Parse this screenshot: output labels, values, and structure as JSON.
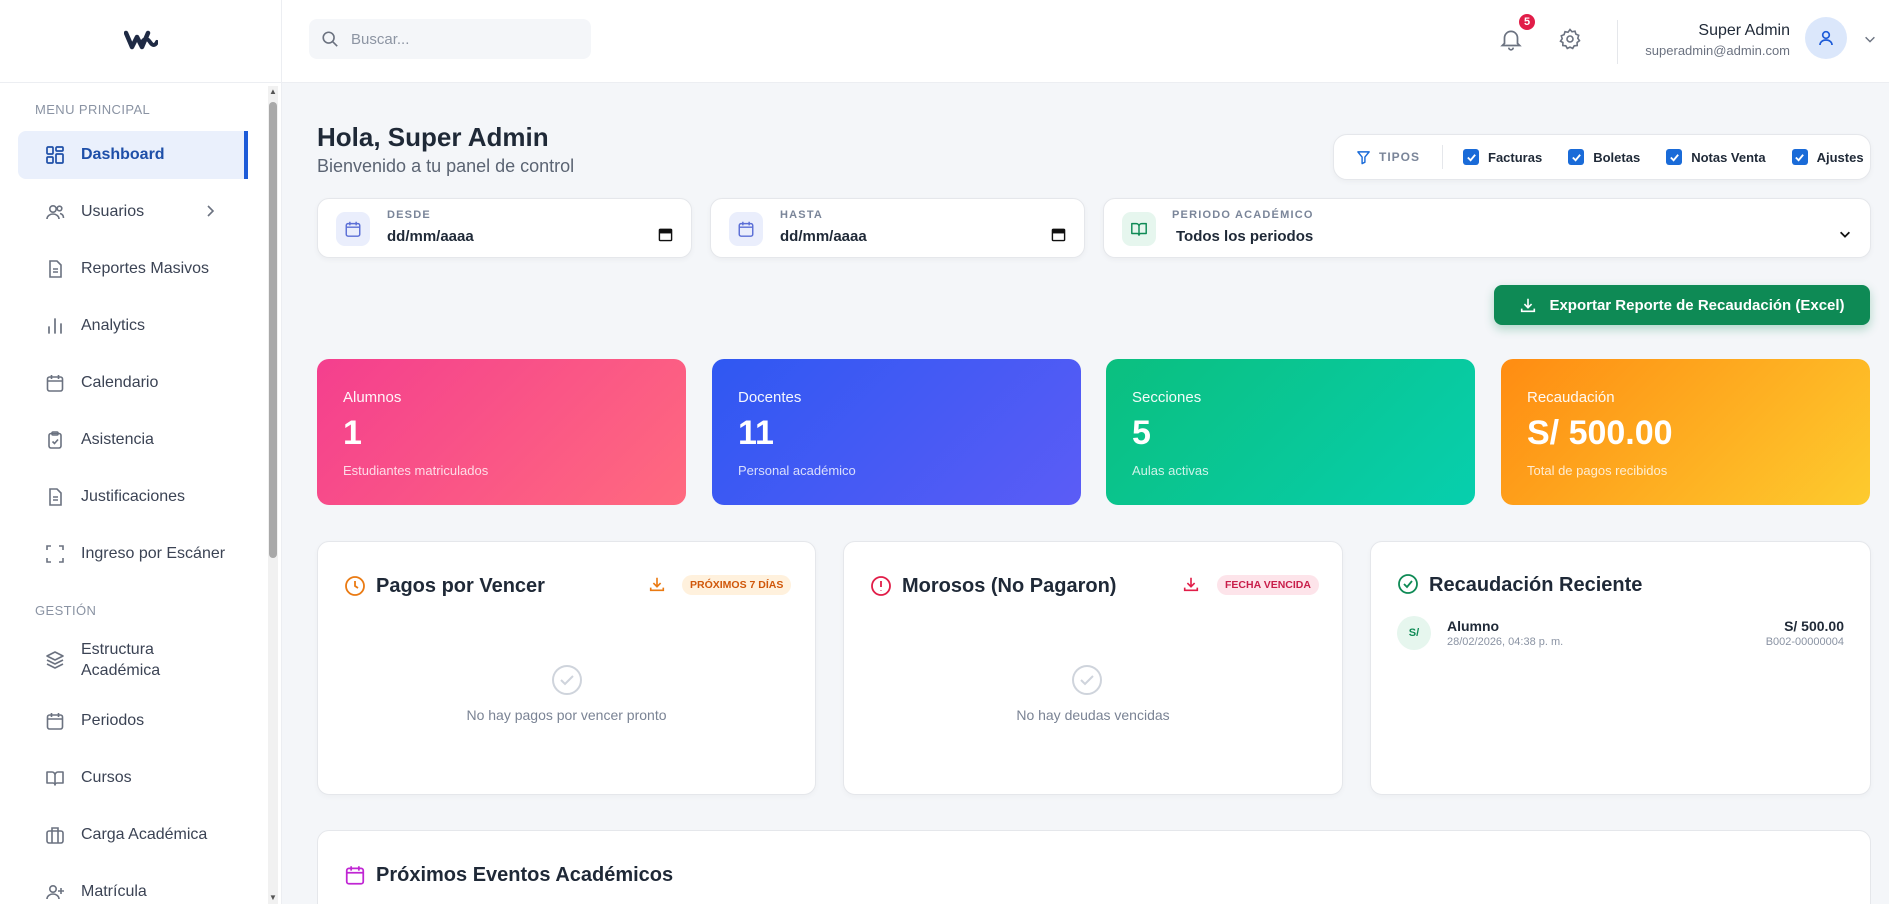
{
  "sidebar": {
    "section_main": "MENU PRINCIPAL",
    "section_manage": "GESTIÓN",
    "items": [
      {
        "label": "Dashboard"
      },
      {
        "label": "Usuarios"
      },
      {
        "label": "Reportes Masivos"
      },
      {
        "label": "Analytics"
      },
      {
        "label": "Calendario"
      },
      {
        "label": "Asistencia"
      },
      {
        "label": "Justificaciones"
      },
      {
        "label": "Ingreso por Escáner"
      }
    ],
    "manage_items": [
      {
        "label": "Estructura Académica"
      },
      {
        "label": "Periodos"
      },
      {
        "label": "Cursos"
      },
      {
        "label": "Carga Académica"
      },
      {
        "label": "Matrícula"
      }
    ]
  },
  "topbar": {
    "search_placeholder": "Buscar...",
    "notification_count": "5",
    "user_name": "Super Admin",
    "user_email": "superadmin@admin.com"
  },
  "greeting": {
    "title": "Hola, Super Admin",
    "subtitle": "Bienvenido a tu panel de control"
  },
  "types_filter": {
    "label": "TIPOS",
    "options": [
      {
        "label": "Facturas",
        "checked": true
      },
      {
        "label": "Boletas",
        "checked": true
      },
      {
        "label": "Notas Venta",
        "checked": true
      },
      {
        "label": "Ajustes",
        "checked": true
      }
    ]
  },
  "filters": {
    "from_label": "DESDE",
    "from_value": "dd/mm/aaaa",
    "to_label": "HASTA",
    "to_value": "dd/mm/aaaa",
    "period_label": "PERIODO ACADÉMICO",
    "period_value": "Todos los periodos"
  },
  "export_button": "Exportar Reporte de Recaudación (Excel)",
  "stats": [
    {
      "label": "Alumnos",
      "value": "1",
      "desc": "Estudiantes matriculados"
    },
    {
      "label": "Docentes",
      "value": "11",
      "desc": "Personal académico"
    },
    {
      "label": "Secciones",
      "value": "5",
      "desc": "Aulas activas"
    },
    {
      "label": "Recaudación",
      "value": "S/ 500.00",
      "desc": "Total de pagos recibidos"
    }
  ],
  "cards": {
    "due": {
      "title": "Pagos por Vencer",
      "tag": "PRÓXIMOS 7 DÍAS",
      "empty": "No hay pagos por vencer pronto"
    },
    "overdue": {
      "title": "Morosos (No Pagaron)",
      "tag": "FECHA VENCIDA",
      "empty": "No hay deudas vencidas"
    },
    "recent": {
      "title": "Recaudación Reciente",
      "items": [
        {
          "avatar": "S/",
          "name": "Alumno",
          "date": "28/02/2026, 04:38 p. m.",
          "amount": "S/ 500.00",
          "doc": "B002-00000004"
        }
      ]
    }
  },
  "events": {
    "title": "Próximos Eventos Académicos"
  },
  "colors": {
    "primary": "#1d5bd8",
    "success": "#0e8a55",
    "danger": "#e11d48",
    "warning": "#ea7a12"
  }
}
